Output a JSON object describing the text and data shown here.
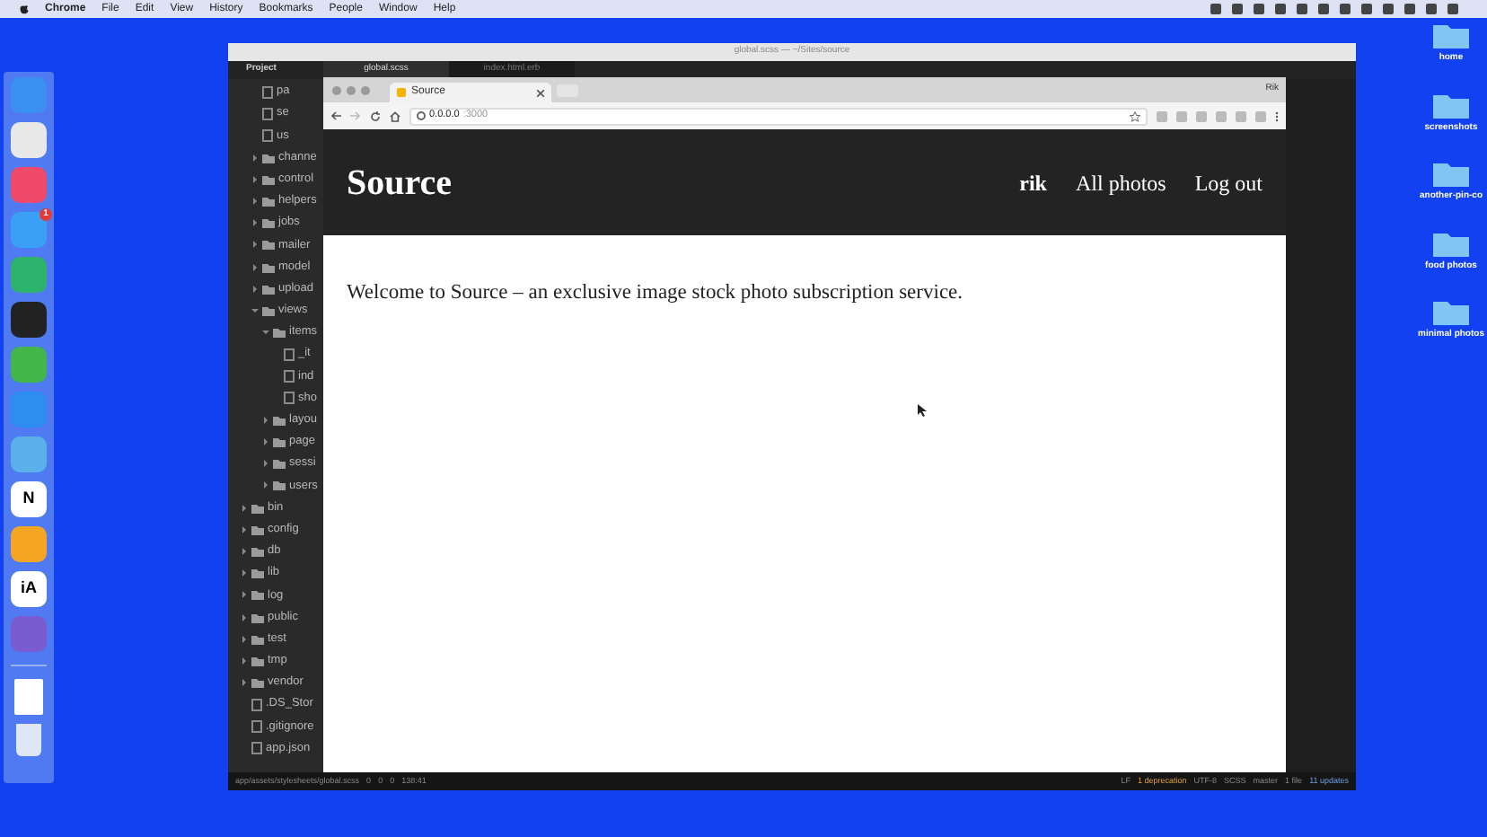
{
  "menu_bar": {
    "app": "Chrome",
    "items": [
      "File",
      "Edit",
      "View",
      "History",
      "Bookmarks",
      "People",
      "Window",
      "Help"
    ]
  },
  "dock": {
    "apps": [
      {
        "kind": "app"
      },
      {
        "kind": "app"
      },
      {
        "kind": "app"
      },
      {
        "kind": "app",
        "badge": "1"
      },
      {
        "kind": "app"
      },
      {
        "kind": "app"
      },
      {
        "kind": "app"
      },
      {
        "kind": "app"
      },
      {
        "kind": "app"
      },
      {
        "kind": "app",
        "label": "N"
      },
      {
        "kind": "app"
      },
      {
        "kind": "app",
        "label": "iA"
      },
      {
        "kind": "app"
      }
    ]
  },
  "desktop_icons": [
    {
      "label": "home"
    },
    {
      "label": "screenshots"
    },
    {
      "label": "another-pin-co"
    },
    {
      "label": "food photos"
    },
    {
      "label": "minimal photos"
    }
  ],
  "editor": {
    "title": "global.scss — ~/Sites/source",
    "panel": "Project",
    "tabs": [
      {
        "label": "global.scss",
        "selected": true
      },
      {
        "label": "index.html.erb",
        "selected": false
      }
    ],
    "tree": [
      {
        "name": "pa",
        "kind": "file"
      },
      {
        "name": "se",
        "kind": "file"
      },
      {
        "name": "us",
        "kind": "file"
      },
      {
        "name": "channe",
        "kind": "folder",
        "expanded": false
      },
      {
        "name": "control",
        "kind": "folder",
        "expanded": false
      },
      {
        "name": "helpers",
        "kind": "folder",
        "expanded": false
      },
      {
        "name": "jobs",
        "kind": "folder",
        "expanded": false
      },
      {
        "name": "mailer",
        "kind": "folder",
        "expanded": false
      },
      {
        "name": "model",
        "kind": "folder",
        "expanded": false
      },
      {
        "name": "upload",
        "kind": "folder",
        "expanded": false
      },
      {
        "name": "views",
        "kind": "folder",
        "expanded": true,
        "children": [
          {
            "name": "items",
            "kind": "folder",
            "expanded": true,
            "children": [
              {
                "name": "_it",
                "kind": "file"
              },
              {
                "name": "ind",
                "kind": "file"
              },
              {
                "name": "sho",
                "kind": "file"
              }
            ]
          },
          {
            "name": "layou",
            "kind": "folder",
            "expanded": false
          },
          {
            "name": "page",
            "kind": "folder",
            "expanded": false
          },
          {
            "name": "sessi",
            "kind": "folder",
            "expanded": false
          },
          {
            "name": "users",
            "kind": "folder",
            "expanded": false
          }
        ]
      }
    ],
    "root_tree": [
      {
        "name": "bin",
        "kind": "folder",
        "expanded": false
      },
      {
        "name": "config",
        "kind": "folder",
        "expanded": false
      },
      {
        "name": "db",
        "kind": "folder",
        "expanded": false
      },
      {
        "name": "lib",
        "kind": "folder",
        "expanded": false
      },
      {
        "name": "log",
        "kind": "folder",
        "expanded": false
      },
      {
        "name": "public",
        "kind": "folder",
        "expanded": false
      },
      {
        "name": "test",
        "kind": "folder",
        "expanded": false
      },
      {
        "name": "tmp",
        "kind": "folder",
        "expanded": false
      },
      {
        "name": "vendor",
        "kind": "folder",
        "expanded": false
      },
      {
        "name": ".DS_Stor",
        "kind": "file"
      },
      {
        "name": ".gitignore",
        "kind": "file"
      },
      {
        "name": "app.json",
        "kind": "file"
      }
    ],
    "status_left": {
      "path": "app/assets/stylesheets/global.scss",
      "errors": "0",
      "warnings": "0",
      "infos": "0",
      "cursor": "138:41"
    },
    "status_right": {
      "line_ending": "LF",
      "deprecation": "1 deprecation",
      "encoding": "UTF-8",
      "grammar": "SCSS",
      "branch": "master",
      "files": "1 file",
      "updates": "11 updates"
    }
  },
  "browser": {
    "tab": "Source",
    "url": "0.0.0.0",
    "port": ":3000",
    "profile": "Rik",
    "site": {
      "logo": "Source",
      "nav": [
        "rik",
        "All photos",
        "Log out"
      ],
      "welcome": "Welcome to Source – an exclusive image stock photo subscription service."
    }
  }
}
